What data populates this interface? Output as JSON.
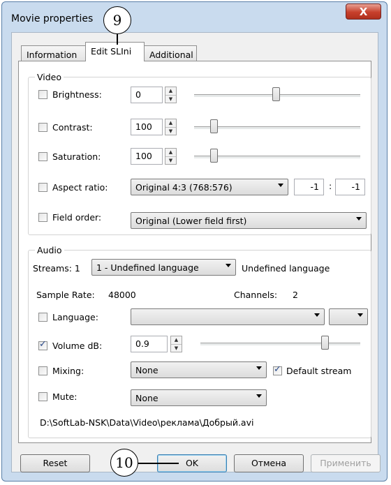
{
  "window": {
    "title": "Movie properties",
    "close_label": "X"
  },
  "tabs": [
    "Information",
    "Edit SLIni",
    "Additional"
  ],
  "active_tab": "Edit SLIni",
  "video": {
    "legend": "Video",
    "brightness": {
      "label": "Brightness:",
      "value": "0",
      "checked": false,
      "slider_level": 0.5
    },
    "contrast": {
      "label": "Contrast:",
      "value": "100",
      "checked": false,
      "slider_level": 0.1
    },
    "saturation": {
      "label": "Saturation:",
      "value": "100",
      "checked": false,
      "slider_level": 0.1
    },
    "aspect": {
      "label": "Aspect ratio:",
      "selected": "Original 4:3 (768:576)",
      "x_value": "-1",
      "separator": ":",
      "y_value": "-1",
      "checked": false
    },
    "field_order": {
      "label": "Field order:",
      "selected": "Original (Lower field first)",
      "checked": false
    }
  },
  "audio": {
    "legend": "Audio",
    "streams_label": "Streams: 1",
    "stream_selected": "1 - Undefined language",
    "stream_language": "Undefined language",
    "sample_rate_label": "Sample Rate:",
    "sample_rate_value": "48000",
    "channels_label": "Channels:",
    "channels_value": "2",
    "language": {
      "label": "Language:",
      "selected": "",
      "secondary": "",
      "checked": false
    },
    "volume": {
      "label": "Volume dB:",
      "value": "0.9",
      "checked": true,
      "slider_level": 0.78
    },
    "mixing": {
      "label": "Mixing:",
      "selected": "None",
      "checked": false
    },
    "default_stream": {
      "label": "Default stream",
      "checked": true
    },
    "mute": {
      "label": "Mute:",
      "selected": "None",
      "checked": false
    },
    "path": "D:\\SoftLab-NSK\\Data\\Video\\реклама\\Добрый.avi"
  },
  "buttons": {
    "reset": "Reset",
    "ok": "OK",
    "cancel": "Отмена",
    "apply": "Применить"
  },
  "callouts": {
    "nine": "9",
    "ten": "10"
  },
  "colors": {
    "frame": "#c9dbee",
    "close": "#c7402c",
    "check": "#2a4a8a"
  }
}
